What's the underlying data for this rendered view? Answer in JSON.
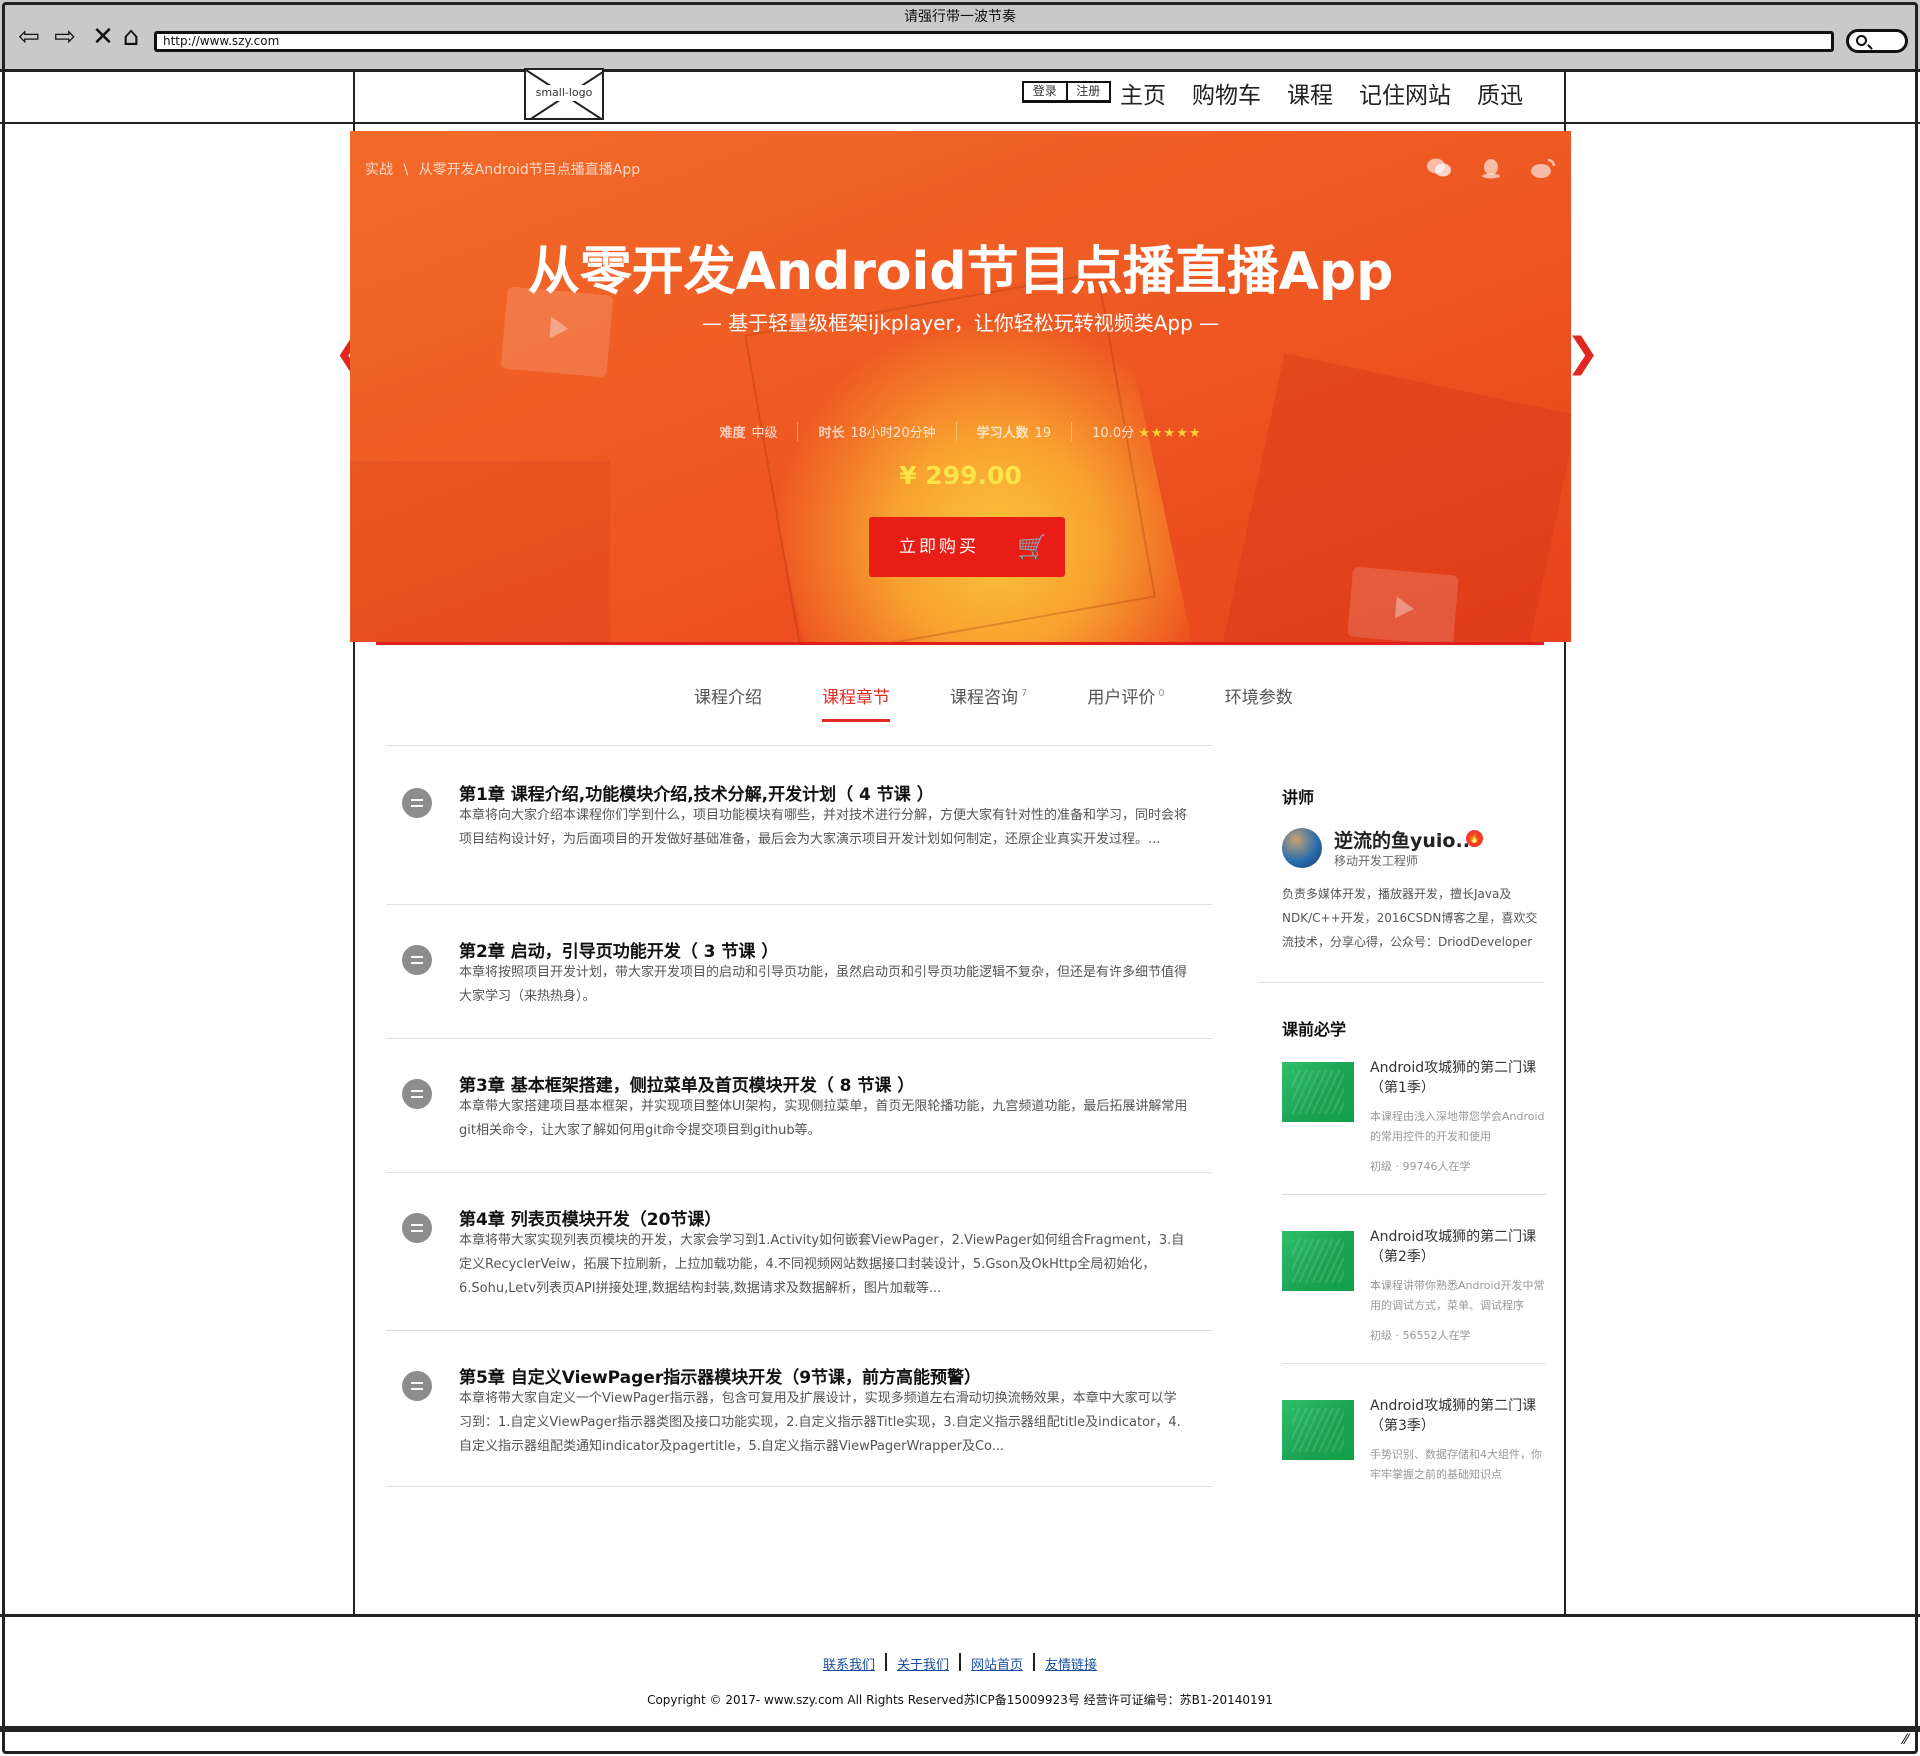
{
  "window": {
    "title": "请强行带一波节奏",
    "url": "http://www.szy.com"
  },
  "header": {
    "logo": "small-logo",
    "login": "登录",
    "register": "注册",
    "nav": [
      "主页",
      "购物车",
      "课程",
      "记住网站",
      "质迅"
    ]
  },
  "hero": {
    "breadcrumb_root": "实战",
    "breadcrumb_sep": "\\",
    "breadcrumb_current": "从零开发Android节目点播直播App",
    "title": "从零开发Android节目点播直播App",
    "subtitle": "— 基于轻量级框架ijkplayer，让你轻松玩转视频类App —",
    "difficulty_label": "难度",
    "difficulty": "中级",
    "duration_label": "时长",
    "duration": "18小时20分钟",
    "learners_label": "学习人数",
    "learners": "19",
    "score": "10.0分",
    "stars": "★★★★★",
    "price": "¥ 299.00",
    "buy_label": "立即购买",
    "social_icons": [
      "wechat-icon",
      "qq-icon",
      "weibo-icon"
    ]
  },
  "tabs": [
    {
      "label": "课程介绍",
      "count": ""
    },
    {
      "label": "课程章节",
      "count": ""
    },
    {
      "label": "课程咨询",
      "count": "7"
    },
    {
      "label": "用户评价",
      "count": "0"
    },
    {
      "label": "环境参数",
      "count": ""
    }
  ],
  "active_tab": "课程章节",
  "chapters": [
    {
      "title": "第1章 课程介绍,功能模块介绍,技术分解,开发计划（ 4 节课 ）",
      "desc": "本章将向大家介绍本课程你们学到什么，项目功能模块有哪些，并对技术进行分解，方便大家有针对性的准备和学习，同时会将项目结构设计好，为后面项目的开发做好基础准备，最后会为大家演示项目开发计划如何制定，还原企业真实开发过程。..."
    },
    {
      "title": "第2章 启动，引导页功能开发（ 3 节课 ）",
      "desc": "本章将按照项目开发计划，带大家开发项目的启动和引导页功能，虽然启动页和引导页功能逻辑不复杂，但还是有许多细节值得大家学习（来热热身）。"
    },
    {
      "title": "第3章 基本框架搭建，侧拉菜单及首页模块开发（ 8 节课 ）",
      "desc": "本章带大家搭建项目基本框架，并实现项目整体UI架构，实现侧拉菜单，首页无限轮播功能，九宫频道功能，最后拓展讲解常用git相关命令，让大家了解如何用git命令提交项目到github等。"
    },
    {
      "title": "第4章 列表页模块开发（20节课）",
      "desc": "本章将带大家实现列表页模块的开发，大家会学习到1.Activity如何嵌套ViewPager，2.ViewPager如何组合Fragment，3.自定义RecyclerVeiw，拓展下拉刷新，上拉加载功能，4.不同视频网站数据接口封装设计，5.Gson及OkHttp全局初始化，6.Sohu,Letv列表页API拼接处理,数据结构封装,数据请求及数据解析，图片加载等..."
    },
    {
      "title": "第5章 自定义ViewPager指示器模块开发（9节课，前方高能预警）",
      "desc": "本章将带大家自定义一个ViewPager指示器，包含可复用及扩展设计，实现多频道左右滑动切换流畅效果，本章中大家可以学习到：1.自定义ViewPager指示器类图及接口功能实现，2.自定义指示器Title实现，3.自定义指示器组配title及indicator，4.自定义指示器组配类通知indicator及pagertitle，5.自定义指示器ViewPagerWrapper及Co..."
    }
  ],
  "sidebar": {
    "teacher_heading": "讲师",
    "teacher_name": "逆流的鱼yuio...",
    "teacher_role": "移动开发工程师",
    "teacher_bio": "负责多媒体开发，播放器开发，擅长Java及NDK/C++开发，2016CSDN博客之星，喜欢交流技术，分享心得，公众号：DriodDeveloper",
    "prereq_heading": "课前必学",
    "courses": [
      {
        "title": "Android攻城狮的第二门课（第1季）",
        "desc": "本课程由浅入深地带您学会Android的常用控件的开发和使用",
        "meta": "初级 · 99746人在学"
      },
      {
        "title": "Android攻城狮的第二门课（第2季）",
        "desc": "本课程讲带你熟悉Android开发中常用的调试方式，菜单、调试程序",
        "meta": "初级 · 56552人在学"
      },
      {
        "title": "Android攻城狮的第二门课（第3季）",
        "desc": "手势识别、数据存储和4大组件，你牢牢掌握之前的基础知识点",
        "meta": ""
      }
    ]
  },
  "footer": {
    "links": [
      "联系我们",
      "关于我们",
      "网站首页",
      "友情链接"
    ],
    "copyright": "Copyright © 2017- www.szy.com All Rights Reserved苏ICP备15009923号 经营许可证编号：苏B1-20140191"
  }
}
